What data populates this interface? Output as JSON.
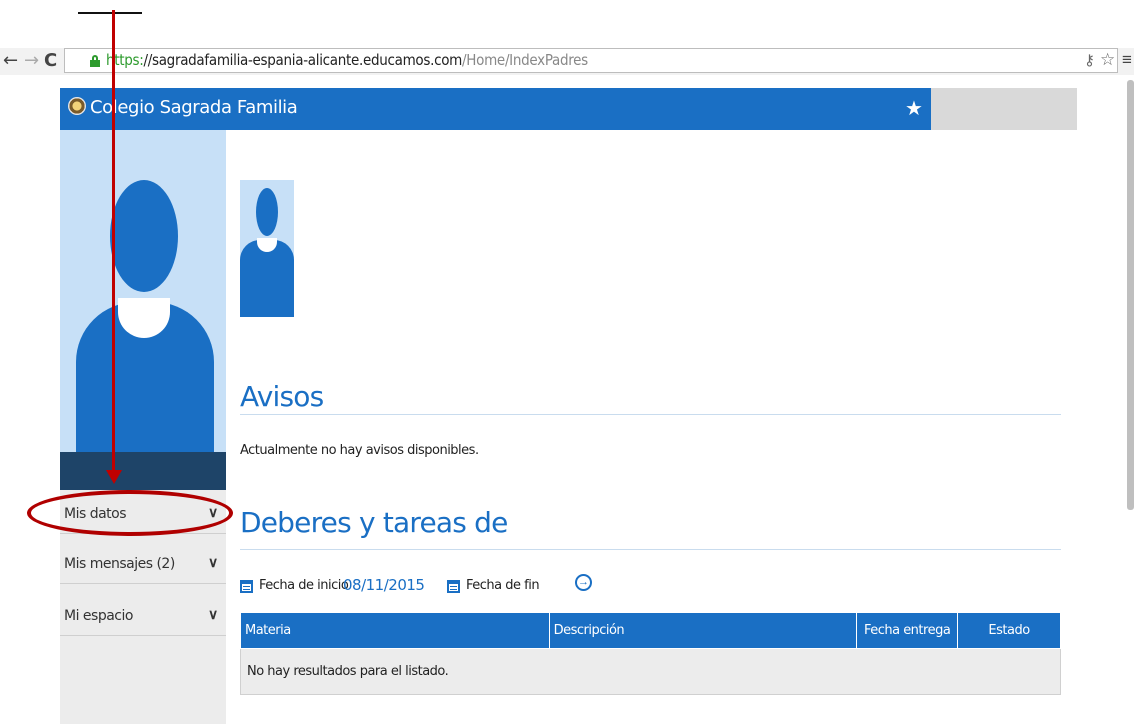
{
  "browser": {
    "url_scheme": "https:",
    "url_host": "//sagradafamilia-espania-alicante.educamos.com",
    "url_path": "/Home/IndexPadres",
    "icons": [
      "back-icon",
      "forward-icon",
      "reload-icon",
      "lock-icon",
      "key-icon",
      "bookmark-star-icon",
      "menu-icon"
    ]
  },
  "header": {
    "title": "Colegio Sagrada Familia",
    "brand_color": "#1a6fc4"
  },
  "sidebar": {
    "items": [
      {
        "label": "Mis datos"
      },
      {
        "label": "Mis mensajes (2)"
      },
      {
        "label": "Mi espacio"
      }
    ]
  },
  "main": {
    "avisos_title": "Avisos",
    "avisos_text": "Actualmente no hay avisos disponibles.",
    "deberes_title": "Deberes y tareas de",
    "filter": {
      "start_label": "Fecha de inicio",
      "start_value": "08/11/2015",
      "end_label": "Fecha de fin"
    },
    "table": {
      "headers": [
        "Materia",
        "Descripción",
        "Fecha entrega",
        "Estado"
      ],
      "empty_message": "No hay resultados para el listado."
    }
  },
  "annotation": {
    "color": "#c00000"
  }
}
